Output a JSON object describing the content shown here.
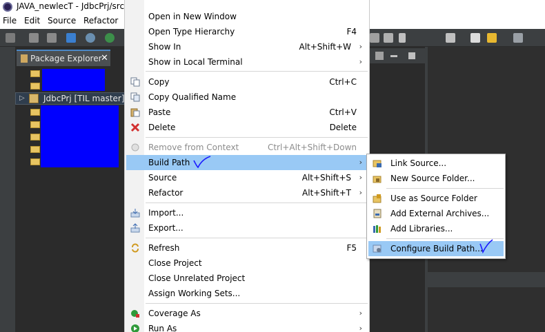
{
  "window": {
    "title": "JAVA_newlecT - JdbcPrj/src/"
  },
  "menubar": {
    "file": "File",
    "edit": "Edit",
    "source": "Source",
    "refactor": "Refactor"
  },
  "package_explorer": {
    "tab_label": "Package Explorer",
    "close_glyph": "✕",
    "selected_project": "JdbcPrj [TIL master]",
    "expand_glyph": "▷"
  },
  "context_menu": {
    "items": [
      {
        "label": "Open in New Window",
        "shortcut": "",
        "submenu": false
      },
      {
        "label": "Open Type Hierarchy",
        "shortcut": "F4",
        "submenu": false
      },
      {
        "label": "Show In",
        "shortcut": "Alt+Shift+W",
        "submenu": true
      },
      {
        "label": "Show in Local Terminal",
        "shortcut": "",
        "submenu": true
      },
      {
        "label": "Copy",
        "shortcut": "Ctrl+C",
        "submenu": false,
        "icon": "copy-icon"
      },
      {
        "label": "Copy Qualified Name",
        "shortcut": "",
        "submenu": false,
        "icon": "copy-qualified-icon"
      },
      {
        "label": "Paste",
        "shortcut": "Ctrl+V",
        "submenu": false,
        "icon": "paste-icon"
      },
      {
        "label": "Delete",
        "shortcut": "Delete",
        "submenu": false,
        "icon": "delete-icon"
      },
      {
        "label": "Remove from Context",
        "shortcut": "Ctrl+Alt+Shift+Down",
        "submenu": false,
        "disabled": true,
        "icon": "remove-context-icon"
      },
      {
        "label": "Build Path",
        "shortcut": "",
        "submenu": true,
        "highlighted": true
      },
      {
        "label": "Source",
        "shortcut": "Alt+Shift+S",
        "submenu": true
      },
      {
        "label": "Refactor",
        "shortcut": "Alt+Shift+T",
        "submenu": true
      },
      {
        "label": "Import...",
        "shortcut": "",
        "submenu": false,
        "icon": "import-icon"
      },
      {
        "label": "Export...",
        "shortcut": "",
        "submenu": false,
        "icon": "export-icon"
      },
      {
        "label": "Refresh",
        "shortcut": "F5",
        "submenu": false,
        "icon": "refresh-icon"
      },
      {
        "label": "Close Project",
        "shortcut": "",
        "submenu": false
      },
      {
        "label": "Close Unrelated Project",
        "shortcut": "",
        "submenu": false
      },
      {
        "label": "Assign Working Sets...",
        "shortcut": "",
        "submenu": false
      },
      {
        "label": "Coverage As",
        "shortcut": "",
        "submenu": true,
        "icon": "coverage-icon"
      },
      {
        "label": "Run As",
        "shortcut": "",
        "submenu": true,
        "icon": "run-icon"
      }
    ]
  },
  "build_path_submenu": {
    "items": [
      {
        "label": "Link Source...",
        "icon": "link-source-icon"
      },
      {
        "label": "New Source Folder...",
        "icon": "new-source-folder-icon"
      },
      {
        "label": "Use as Source Folder",
        "icon": "use-source-folder-icon"
      },
      {
        "label": "Add External Archives...",
        "icon": "archive-icon"
      },
      {
        "label": "Add Libraries...",
        "icon": "libraries-icon"
      },
      {
        "label": "Configure Build Path...",
        "icon": "configure-build-path-icon",
        "highlighted": true
      }
    ]
  },
  "colors": {
    "highlight": "#99c9f5",
    "redaction": "#0000ff",
    "annotation_check": "#1a1aff",
    "dark_bg": "#2b2b2b"
  }
}
